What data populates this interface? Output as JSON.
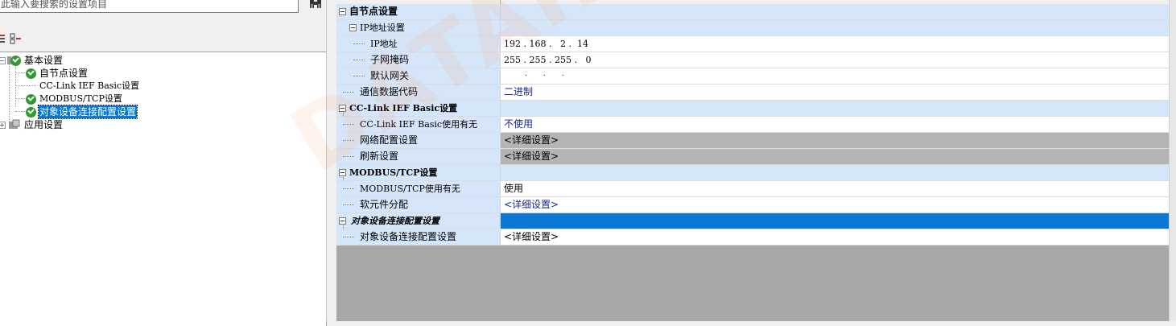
{
  "search": {
    "placeholder": "此输入要搜索的设置项目"
  },
  "tree": {
    "items": [
      {
        "label": "基本设置"
      },
      {
        "label": "自节点设置"
      },
      {
        "label": "CC-Link IEF Basic设置"
      },
      {
        "label": "MODBUS/TCP设置"
      },
      {
        "label": "对象设备连接配置设置"
      },
      {
        "label": "应用设置"
      }
    ]
  },
  "grid": {
    "rows": [
      {
        "name": "自节点设置",
        "value": ""
      },
      {
        "name": "IP地址设置",
        "value": ""
      },
      {
        "name": "IP地址",
        "value": "192 . 168 .   2 .  14"
      },
      {
        "name": "子网掩码",
        "value": "255 . 255 . 255 .   0"
      },
      {
        "name": "默认网关",
        "value": ".       .       ."
      },
      {
        "name": "通信数据代码",
        "value": "二进制"
      },
      {
        "name": "CC-Link IEF Basic设置",
        "value": ""
      },
      {
        "name": "CC-Link IEF Basic使用有无",
        "value": "不使用"
      },
      {
        "name": "网络配置设置",
        "value": "<详细设置>"
      },
      {
        "name": "刷新设置",
        "value": "<详细设置>"
      },
      {
        "name": "MODBUS/TCP设置",
        "value": ""
      },
      {
        "name": "MODBUS/TCP使用有无",
        "value": "使用"
      },
      {
        "name": "软元件分配",
        "value": "<详细设置>"
      },
      {
        "name": "对象设备连接配置设置",
        "value": ""
      },
      {
        "name": "对象设备连接配置设置",
        "value": "<详细设置>"
      }
    ]
  },
  "watermark": "DATAIE",
  "colors": {
    "selection": "#0078d7",
    "category_bg": "#d6e6fa",
    "disabled_bg": "#b4b4b4",
    "check": "#2f9a2f"
  }
}
